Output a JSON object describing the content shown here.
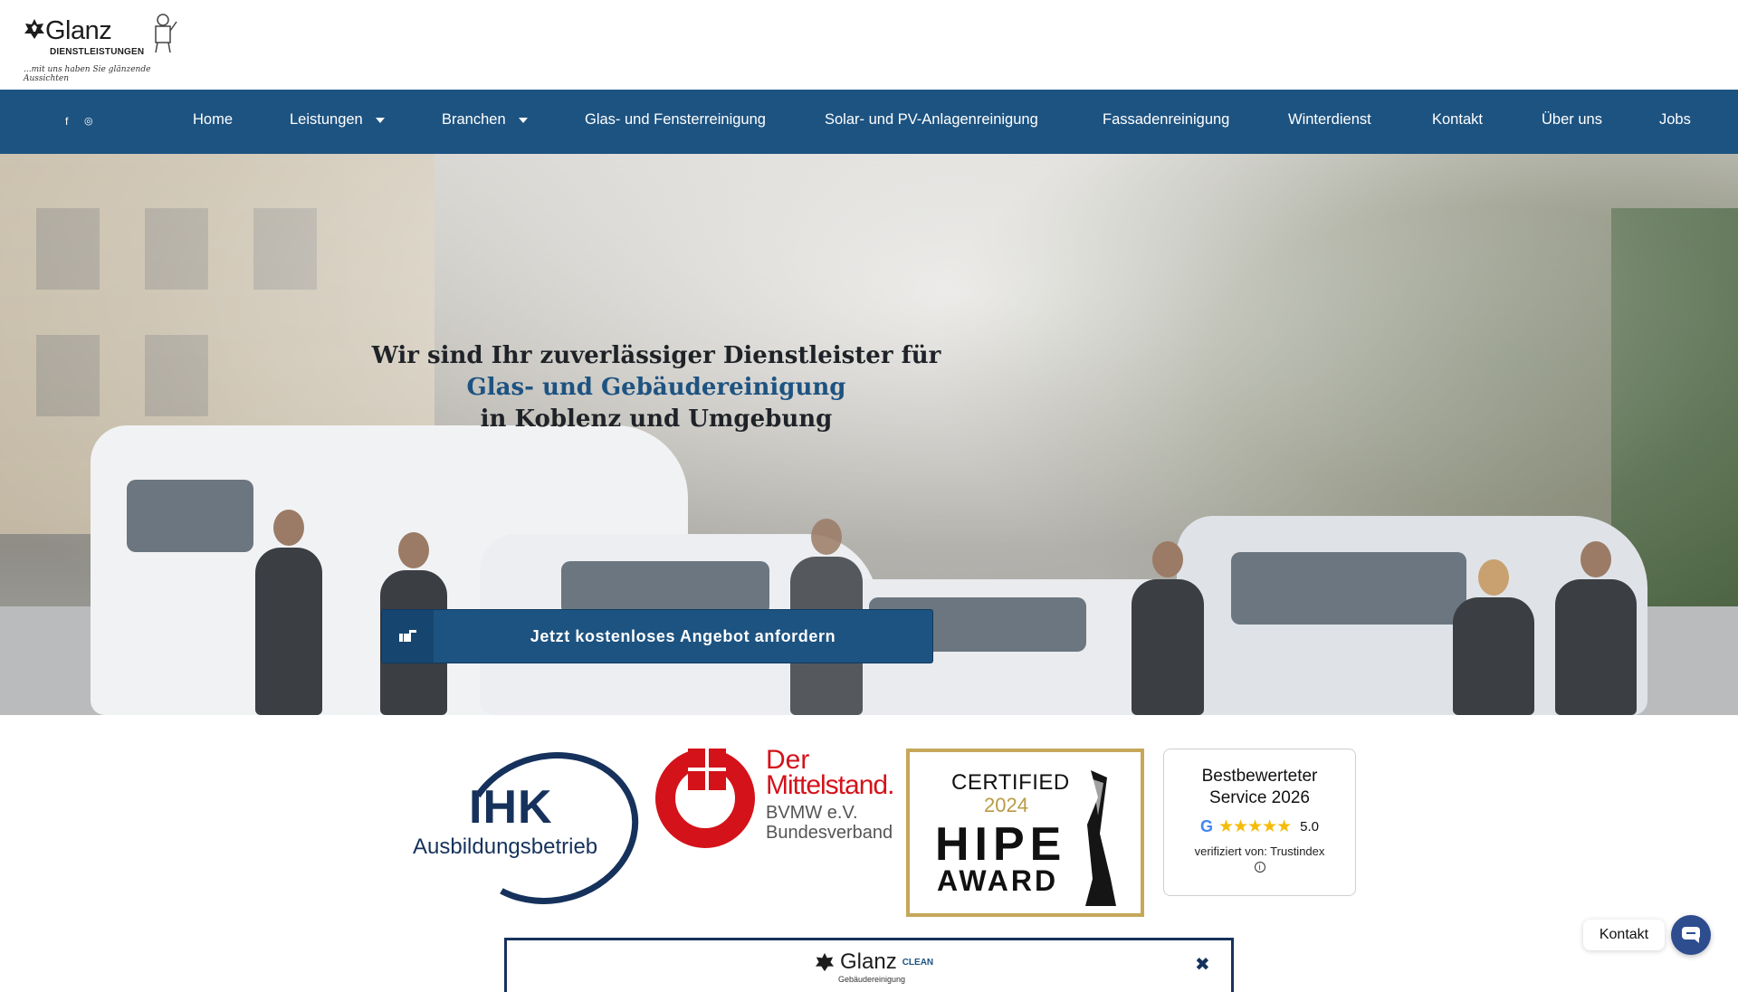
{
  "header": {
    "logo_brand": "Glanz",
    "logo_sub": "DIENSTLEISTUNGEN",
    "logo_tagline": "...mit uns haben Sie glänzende Aussichten"
  },
  "social": {
    "facebook": "f",
    "instagram": "◎"
  },
  "nav": {
    "items": [
      {
        "label": "Home"
      },
      {
        "label": "Leistungen"
      },
      {
        "label": "Branchen"
      },
      {
        "label": "Glas- und Fensterreinigung"
      },
      {
        "label": "Solar- und PV-Anlagenreinigung"
      },
      {
        "label": "Fassadenreinigung"
      },
      {
        "label": "Winterdienst"
      },
      {
        "label": "Kontakt"
      },
      {
        "label": "Über uns"
      },
      {
        "label": "Jobs"
      }
    ]
  },
  "hero": {
    "line1": "Wir sind Ihr  zuverlässiger Dienstleister  für",
    "line2": "Glas- und  Gebäudereinigung",
    "line3": "in Koblenz und Umgebung",
    "cta_label": "Jetzt kostenloses Angebot anfordern",
    "cta_icon": "hand-pointing-icon"
  },
  "badges": {
    "ihk": {
      "title": "IHK",
      "subtitle": "Ausbildungsbetrieb"
    },
    "mittelstand": {
      "line1": "Der",
      "line2": "Mittelstand.",
      "line3": "BVMW e.V.",
      "line4": "Bundesverband"
    },
    "hipe": {
      "line1": "CERTIFIED",
      "year": "2024",
      "line2": "HIPE",
      "line3": "AWARD"
    },
    "trustindex": {
      "title_line1": "Bestbewerteter",
      "title_line2": "Service 2026",
      "google": "G",
      "stars": "★★★★★",
      "score": "5.0",
      "verified": "verifiziert von: Trustindex",
      "info": "i"
    }
  },
  "popup": {
    "brand": "Glanz",
    "clean": "CLEAN",
    "sub": "Gebäudereinigung",
    "close": "✖"
  },
  "contact_widget": {
    "label": "Kontakt"
  },
  "colors": {
    "nav_bg": "#1d5381",
    "accent": "#1d5381",
    "cta_bg": "#1d5381",
    "mittelstand_red": "#d4121a",
    "hipe_gold": "#c5a85a",
    "star_yellow": "#f6bb06"
  }
}
